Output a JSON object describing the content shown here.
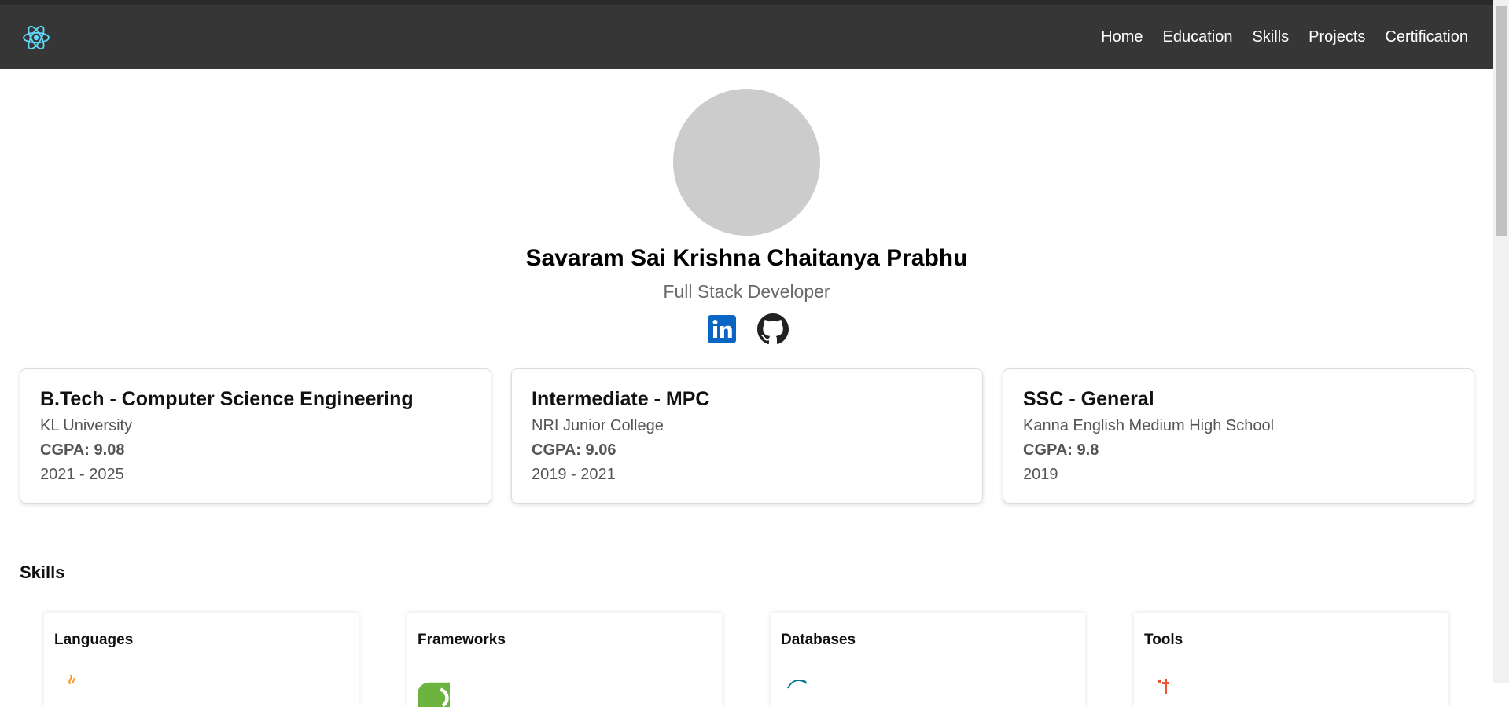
{
  "navbar": {
    "logo_icon": "react-atom-icon",
    "links": [
      "Home",
      "Education",
      "Skills",
      "Projects",
      "Certification"
    ]
  },
  "profile": {
    "name": "Savaram Sai Krishna Chaitanya Prabhu",
    "role": "Full Stack Developer",
    "socials": [
      {
        "icon": "linkedin-icon",
        "color": "#0a66c2"
      },
      {
        "icon": "github-icon",
        "color": "#222222"
      }
    ]
  },
  "education": [
    {
      "degree": "B.Tech - Computer Science Engineering",
      "school": "KL University",
      "cgpa": "CGPA: 9.08",
      "years": "2021 - 2025"
    },
    {
      "degree": "Intermediate - MPC",
      "school": "NRI Junior College",
      "cgpa": "CGPA: 9.06",
      "years": "2019 - 2021"
    },
    {
      "degree": "SSC - General",
      "school": "Kanna English Medium High School",
      "cgpa": "CGPA: 9.8",
      "years": "2019"
    }
  ],
  "skills": {
    "title": "Skills",
    "categories": [
      {
        "label": "Languages",
        "icon": "java-icon"
      },
      {
        "label": "Frameworks",
        "icon": "spring-icon"
      },
      {
        "label": "Databases",
        "icon": "mysql-icon"
      },
      {
        "label": "Tools",
        "icon": "git-icon"
      }
    ]
  },
  "colors": {
    "navbar": "#363636",
    "accent_react": "#61dafb",
    "avatar": "#cccccc"
  }
}
